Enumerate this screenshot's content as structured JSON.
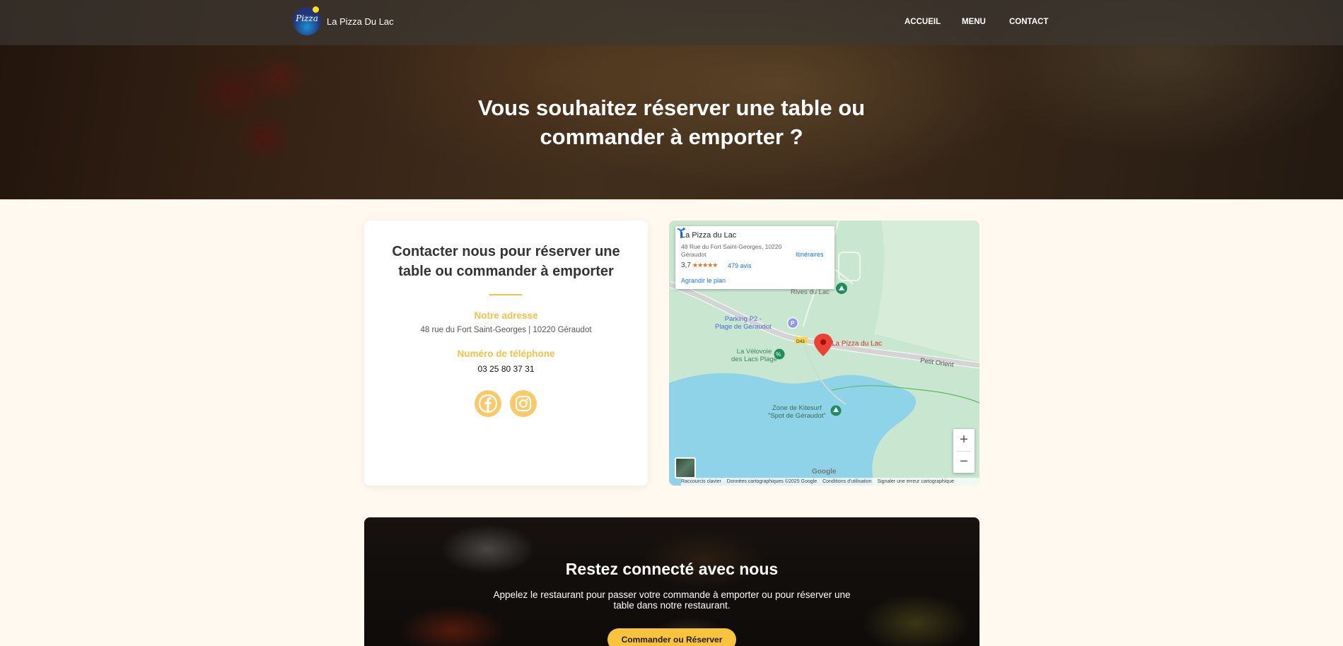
{
  "nav": {
    "logo_text": "Pizza",
    "brand": "La Pizza Du Lac",
    "links": [
      "ACCUEIL",
      "MENU",
      "CONTACT"
    ]
  },
  "hero": {
    "title_line1": "Vous souhaitez réserver une table ou",
    "title_line2": "commander à emporter ?"
  },
  "contact": {
    "title_line1": "Contacter nous pour réserver une",
    "title_line2": "table ou commander à emporter",
    "address_label": "Notre adresse",
    "address": "48 rue du Fort Saint-Georges | 10220 Géraudot",
    "phone_label": "Numéro de téléphone",
    "phone": "03 25 80 37 31",
    "social": [
      {
        "icon": "facebook-icon"
      },
      {
        "icon": "instagram-icon"
      }
    ]
  },
  "map": {
    "info_name": "La Pizza du Lac",
    "info_address": "48 Rue du Fort Saint-Georges, 10220 Géraudot",
    "rating": "3,7",
    "stars": "★★★★★",
    "reviews": "479 avis",
    "enlarge": "Agrandir le plan",
    "directions": "Itinéraires",
    "labels": {
      "rives": "Rives du Lac",
      "parking_line1": "Parking P2 -",
      "parking_line2": "Plage de Géraudot",
      "road_tag": "D43",
      "pin": "La Pizza du Lac",
      "velovoie_line1": "La Vélovoie",
      "velovoie_line2": "des Lacs Plage",
      "petit_orient": "Petit Orient",
      "kitesurf_line1": "Zone de Kitesurf",
      "kitesurf_line2": "\"Spot de Géraudot\""
    },
    "zoom_in": "+",
    "zoom_out": "−",
    "google": "Google",
    "footer": [
      "Raccourcis clavier",
      "Données cartographiques ©2025 Google",
      "Conditions d'utilisation",
      "Signaler une erreur cartographique"
    ]
  },
  "banner": {
    "title": "Restez connecté avec nous",
    "text": "Appelez le restaurant pour passer votre commande à emporter ou pour réserver une table dans notre restaurant.",
    "button": "Commander ou Réserver"
  }
}
